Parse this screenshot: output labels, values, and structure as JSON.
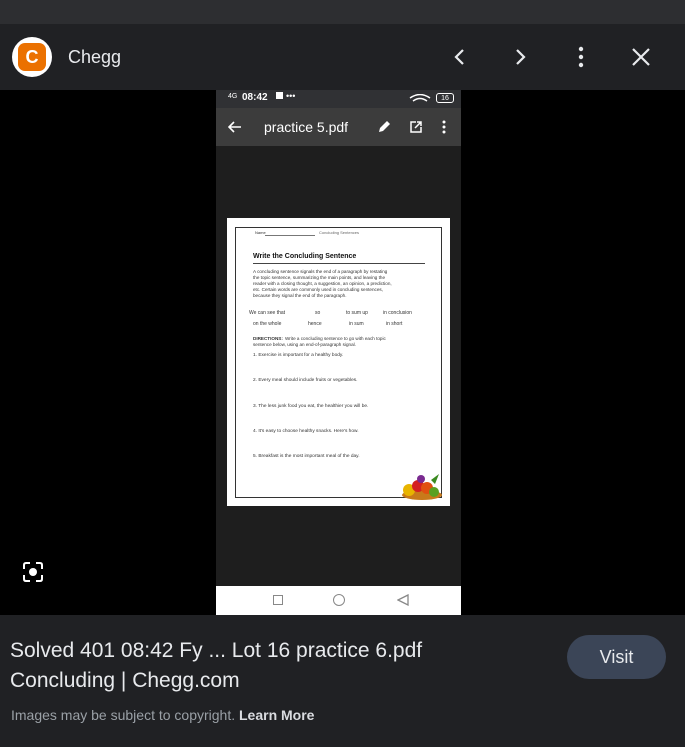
{
  "header": {
    "site_name": "Chegg",
    "logo_letter": "C",
    "brand_color": "#eb7100"
  },
  "phone": {
    "status_time": "08:42",
    "status_left_label": "4G",
    "status_extra": "•••",
    "battery": "16",
    "app_title": "practice 5.pdf"
  },
  "worksheet": {
    "name_label": "Name",
    "topic": "Concluding Sentences",
    "heading": "Write the Concluding Sentence",
    "intro": [
      "A concluding sentence signals the end of a paragraph by restating",
      "the topic sentence, summarizing the main points, and leaving the",
      "reader with a closing thought, a suggestion, an opinion, a prediction,",
      "etc. Certain words are commonly used in concluding sentences,",
      "because they signal the end of the paragraph."
    ],
    "words_row1": [
      "We can see that",
      "so",
      "to sum up",
      "in conclusion"
    ],
    "words_row2": [
      "on the whole",
      "hence",
      "in sum",
      "in short"
    ],
    "directions_label": "DIRECTIONS:",
    "directions": [
      "Write a concluding sentence to go with each topic",
      "sentence below, using an end-of-paragraph signal."
    ],
    "items": [
      "1. Exercise is important for a healthy body.",
      "2. Every meal should include fruits or vegetables.",
      "3. The less junk food you eat, the healthier you will be.",
      "4. It's easy to choose healthy snacks. Here's how.",
      "5. Breakfast is the most important meal of the day."
    ]
  },
  "result": {
    "title_line1": "Solved 401 08:42 Fy ... Lot 16 practice 6.pdf",
    "title_line2": "Concluding | Chegg.com",
    "visit_label": "Visit",
    "copyright_text": "Images may be subject to copyright.",
    "learn_more": "Learn More"
  }
}
